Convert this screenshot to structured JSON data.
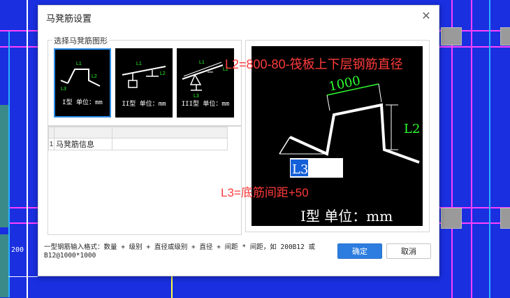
{
  "dialog": {
    "title": "马凳筋设置",
    "close_icon": "close-icon",
    "group_label": "选择马凳筋图形",
    "thumbnails": [
      {
        "caption": "I型 单位：mm",
        "selected": true
      },
      {
        "caption": "II型 单位：mm",
        "selected": false
      },
      {
        "caption": "III型 单位：mm",
        "selected": false
      }
    ],
    "table": {
      "rows": [
        {
          "index": "1",
          "name": "马凳筋信息",
          "value": ""
        }
      ]
    },
    "preview": {
      "dim_1000": "1000",
      "dim_L2": "L2",
      "dim_L3": "L3",
      "caption": "I型 单位：mm",
      "annotation_1": "L2=800-80-筏板上下层钢筋直径",
      "annotation_2": "L3=底筋间距+50",
      "annotation_color": "#ff3b3b"
    },
    "hint_text": "一型钢筋输入格式：数量 + 级别 + 直径或级别 + 直径 + 间距 * 间距，如 200B12 或 B12@1000*1000",
    "ok_label": "确定",
    "cancel_label": "取消"
  },
  "thumb_labels": {
    "L1": "L1",
    "L2": "L2",
    "L3": "L3"
  },
  "background": {
    "dimension_text": "200",
    "cad_blue": "#1a2fe0",
    "accent_blue": "#2d7de0"
  }
}
